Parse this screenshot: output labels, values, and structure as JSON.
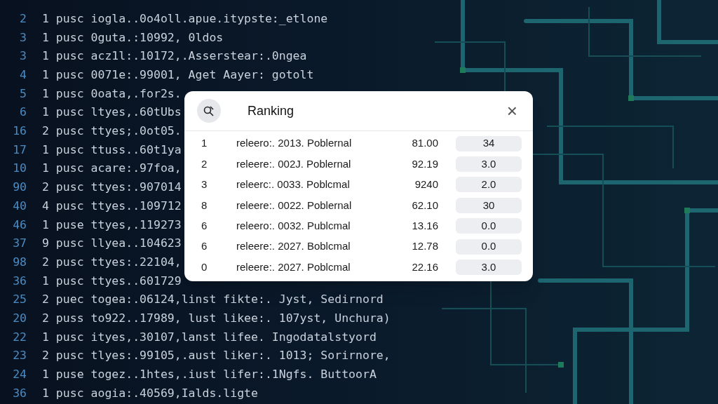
{
  "code_lines": [
    {
      "line_number": "2",
      "text": "1 pusc iogla..0o4oll.apue.itypste:_etlone"
    },
    {
      "line_number": "3",
      "text": "1 pusc 0guta.:10992, 0ldos"
    },
    {
      "line_number": "3",
      "text": "1 pusc acz1l:.10172,.Asserstear:.0ngea"
    },
    {
      "line_number": "4",
      "text": "1 pusc 0071e:.99001, Aget Aayer: gotolt"
    },
    {
      "line_number": "5",
      "text": "1 pusc 0oata,.for2s."
    },
    {
      "line_number": "6",
      "text": "1 pusc ltyes,.60tUbs"
    },
    {
      "line_number": "16",
      "text": "2 pusc ttyes;.0ot05."
    },
    {
      "line_number": "17",
      "text": "1 pusc ttuss..60t1ya"
    },
    {
      "line_number": "10",
      "text": "1 pusc acare:.97foa,"
    },
    {
      "line_number": "90",
      "text": "2 pusc ttyes:.907014"
    },
    {
      "line_number": "40",
      "text": "4 pusc ttyes..109712"
    },
    {
      "line_number": "46",
      "text": "1 puse ttyes,.119273"
    },
    {
      "line_number": "37",
      "text": "9 pusc llyea..104623"
    },
    {
      "line_number": "98",
      "text": "2 pusc ttyes:.22104,"
    },
    {
      "line_number": "36",
      "text": "1 pusc ttyes..601729"
    },
    {
      "line_number": "25",
      "text": "2 puec togea:.06124,linst fikte:. Jyst, Sedirnord"
    },
    {
      "line_number": "20",
      "text": "2 puss to922..17989, lust likee:. 107yst, Unchura)"
    },
    {
      "line_number": "22",
      "text": "1 pusc ityes,.30107,lanst lifee. Ingodatalstyord"
    },
    {
      "line_number": "23",
      "text": "2 pusc tlyes:.99105,.aust liker:. 1013; Sorirnore,"
    },
    {
      "line_number": "24",
      "text": "1 puse togez..1htes,.iust lifer:.1Ngfs. ButtoorA"
    },
    {
      "line_number": "36",
      "text": "1 pusc aogia:.40569,Ialds.ligte"
    }
  ],
  "dialog": {
    "title": "Ranking",
    "close": "×",
    "rows": [
      {
        "rank": "1",
        "name": "releero:. 2013. Poblernal",
        "score": "81.00",
        "value": "34"
      },
      {
        "rank": "2",
        "name": "releere:. 002J. Poblernal",
        "score": "92.19",
        "value": "3.0"
      },
      {
        "rank": "3",
        "name": "releerc:. 0033. Poblcmal",
        "score": "9240",
        "value": "2.0"
      },
      {
        "rank": "8",
        "name": "releere:. 0022. Poblernal",
        "score": "62.10",
        "value": "30"
      },
      {
        "rank": "6",
        "name": "releero:. 0032. Publcmal",
        "score": "13.16",
        "value": "0.0"
      },
      {
        "rank": "6",
        "name": "releere:. 2027. Boblcmal",
        "score": "12.78",
        "value": "0.0"
      },
      {
        "rank": "0",
        "name": "releere:. 2027. Poblcmal",
        "score": "22.16",
        "value": "3.0"
      }
    ]
  }
}
